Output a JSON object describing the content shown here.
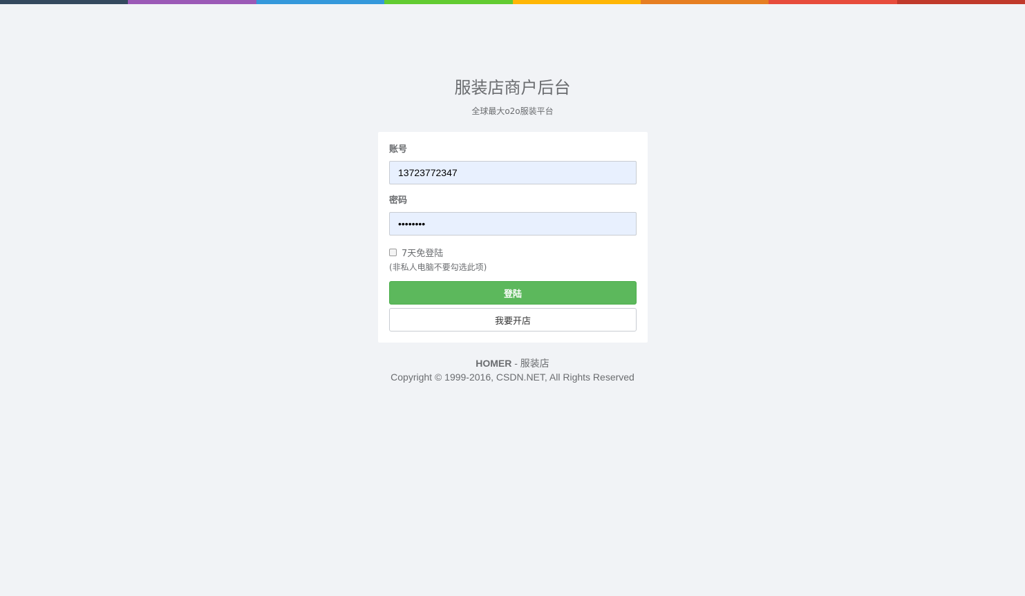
{
  "colors": {
    "background": "#f1f3f6",
    "primary_button": "#5cb85c",
    "color_line": [
      "#34495e",
      "#9b59b6",
      "#3498db",
      "#62cb31",
      "#ffb606",
      "#e67e22",
      "#e74c3c",
      "#c0392b"
    ]
  },
  "header": {
    "title": "服装店商户后台",
    "subtitle": "全球最大o2o服装平台"
  },
  "form": {
    "account_label": "账号",
    "account_value": "13723772347",
    "password_label": "密码",
    "password_value": "••••••••",
    "remember_label": "7天免登陆",
    "remember_checked": false,
    "remember_help": "(非私人电脑不要勾选此项)",
    "login_button": "登陆",
    "open_shop_button": "我要开店"
  },
  "footer": {
    "brand": "HOMER",
    "separator": " - ",
    "brand_suffix": "服装店",
    "copyright": "Copyright © 1999-2016, CSDN.NET, All Rights Reserved"
  }
}
